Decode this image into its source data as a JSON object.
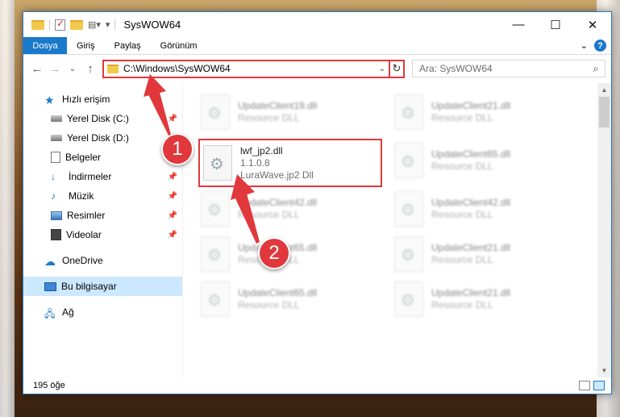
{
  "window": {
    "title": "SysWOW64",
    "minimize": "—",
    "maximize": "☐",
    "close": "✕"
  },
  "ribbon": {
    "tabs": [
      "Dosya",
      "Giriş",
      "Paylaş",
      "Görünüm"
    ],
    "expand": "⌄",
    "help": "?"
  },
  "nav": {
    "back": "←",
    "forward": "→",
    "recent": "⌄",
    "up": "↑"
  },
  "address": {
    "path": "C:\\Windows\\SysWOW64",
    "dropdown": "⌄",
    "refresh": "↻"
  },
  "search": {
    "placeholder": "Ara: SysWOW64",
    "icon": "⌕"
  },
  "sidebar": {
    "items": [
      {
        "label": "Hızlı erişim",
        "icon": "star-icon"
      },
      {
        "label": "Yerel Disk (C:)",
        "icon": "drive-icon",
        "pinned": true
      },
      {
        "label": "Yerel Disk (D:)",
        "icon": "drive-icon",
        "pinned": true
      },
      {
        "label": "Belgeler",
        "icon": "documents-icon",
        "pinned": true
      },
      {
        "label": "İndirmeler",
        "icon": "downloads-icon",
        "pinned": true
      },
      {
        "label": "Müzik",
        "icon": "music-icon",
        "pinned": true
      },
      {
        "label": "Resimler",
        "icon": "pictures-icon",
        "pinned": true
      },
      {
        "label": "Videolar",
        "icon": "videos-icon",
        "pinned": true
      },
      {
        "label": "OneDrive",
        "icon": "cloud-icon"
      },
      {
        "label": "Bu bilgisayar",
        "icon": "computer-icon",
        "selected": true
      },
      {
        "label": "Ağ",
        "icon": "network-icon"
      }
    ]
  },
  "files": {
    "highlighted": {
      "name": "lwf_jp2.dll",
      "version": "1.1.0.8",
      "description": "LuraWave.jp2 Dll"
    },
    "others": [
      {
        "name": "UpdateClient19.dll",
        "description": "Resource DLL"
      },
      {
        "name": "UpdateClient21.dll",
        "description": "Resource DLL"
      },
      {
        "name": "UpdateClient65.dll",
        "description": "Resource DLL"
      },
      {
        "name": "UpdateClient42.dll",
        "description": "Resource DLL"
      },
      {
        "name": "UpdateClient42.dll",
        "description": "Resource DLL"
      },
      {
        "name": "UpdateClient65.dll",
        "description": "Resource DLL"
      },
      {
        "name": "UpdateClient21.dll",
        "description": "Resource DLL"
      },
      {
        "name": "UpdateClient65.dll",
        "description": "Resource DLL"
      },
      {
        "name": "UpdateClient21.dll",
        "description": "Resource DLL"
      }
    ]
  },
  "status": {
    "count": "195 öğe"
  },
  "annotations": {
    "step1": "1",
    "step2": "2",
    "color": "#e0383c"
  }
}
